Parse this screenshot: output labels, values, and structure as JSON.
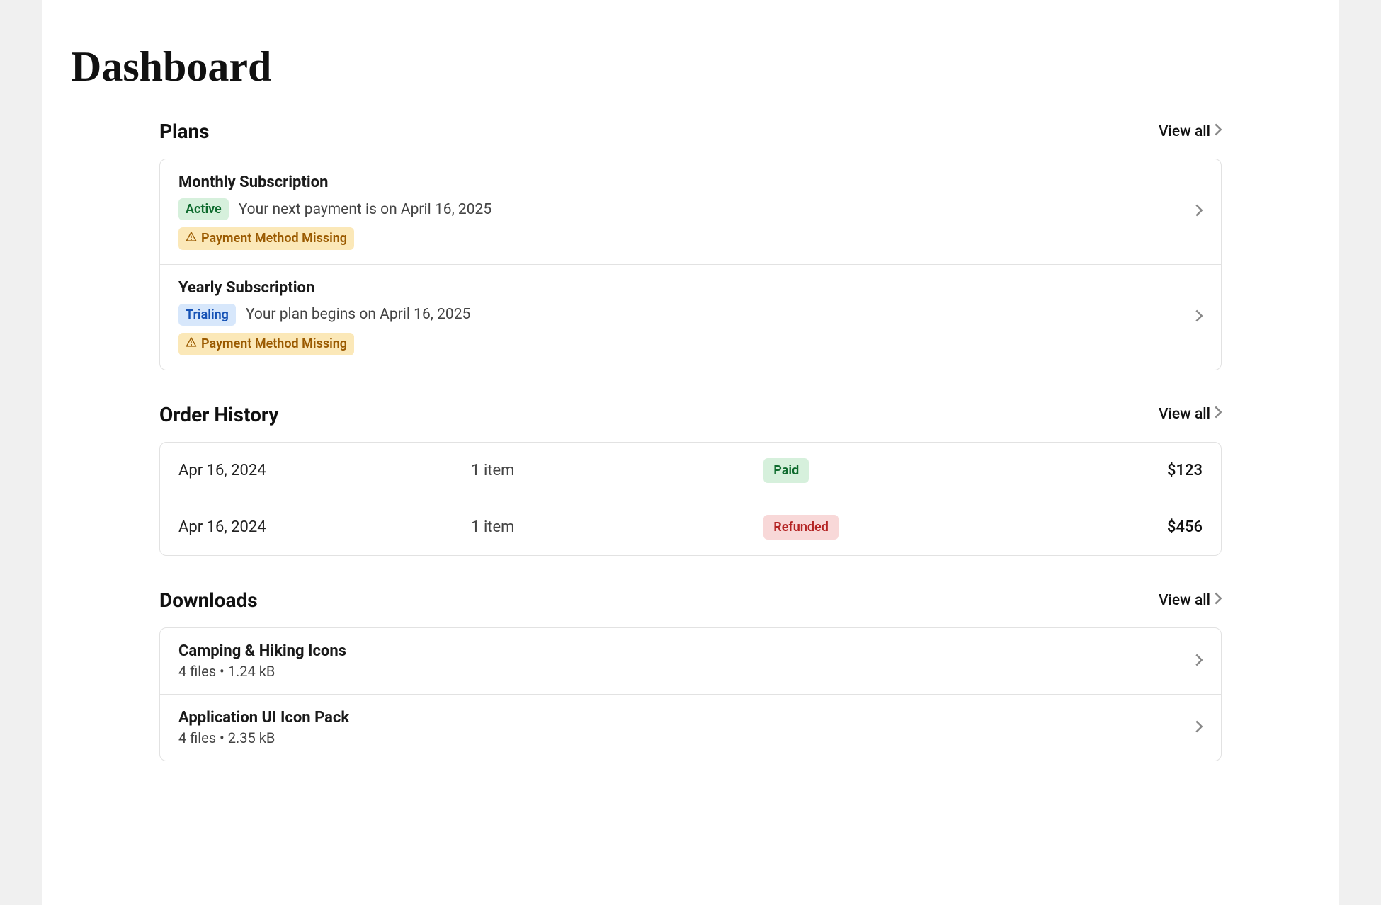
{
  "page": {
    "title": "Dashboard"
  },
  "labels": {
    "view_all": "View all"
  },
  "plans": {
    "title": "Plans",
    "items": [
      {
        "name": "Monthly Subscription",
        "status": "Active",
        "detail": "Your next payment is on April 16, 2025",
        "warning": "Payment Method Missing"
      },
      {
        "name": "Yearly Subscription",
        "status": "Trialing",
        "detail": "Your plan begins on April 16, 2025",
        "warning": "Payment Method Missing"
      }
    ]
  },
  "orders": {
    "title": "Order History",
    "items": [
      {
        "date": "Apr 16, 2024",
        "items": "1 item",
        "status": "Paid",
        "amount": "$123"
      },
      {
        "date": "Apr 16, 2024",
        "items": "1 item",
        "status": "Refunded",
        "amount": "$456"
      }
    ]
  },
  "downloads": {
    "title": "Downloads",
    "items": [
      {
        "name": "Camping & Hiking Icons",
        "meta": "4 files • 1.24 kB"
      },
      {
        "name": "Application UI Icon Pack",
        "meta": "4 files • 2.35 kB"
      }
    ]
  }
}
